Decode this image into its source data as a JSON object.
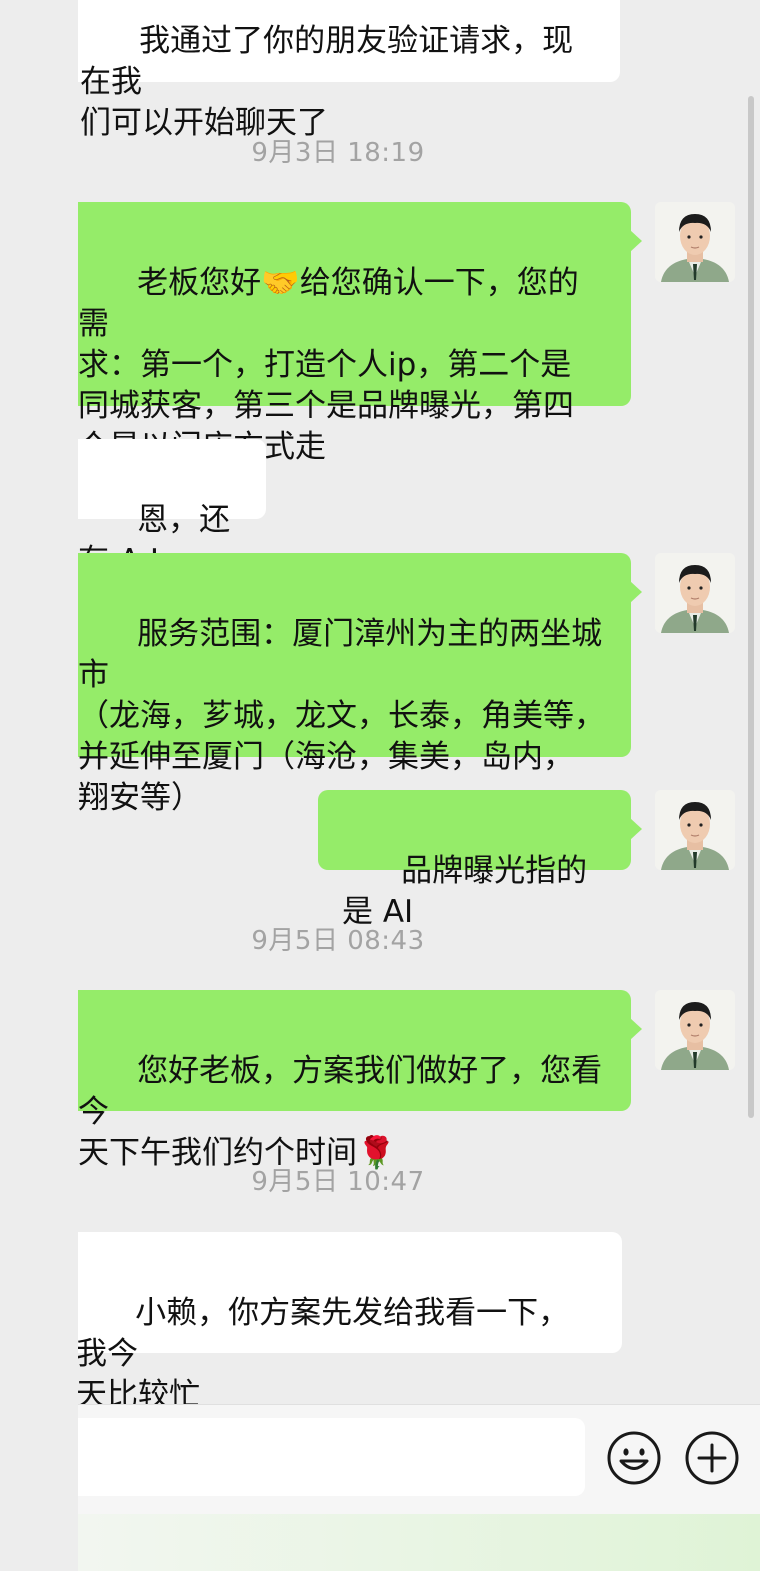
{
  "messages": [
    {
      "type": "in",
      "lines": [
        "我通过了你的朋友验证请求，现在我",
        "们可以开始聊天了"
      ]
    },
    {
      "type": "time",
      "text": "9月3日 18:19"
    },
    {
      "type": "out",
      "lines": [
        "老板您好🤝给您确认一下，您的需",
        "求：第一个，打造个人ip，第二个是",
        "同城获客，第三个是品牌曝光，第四",
        "个是以门店方式走"
      ]
    },
    {
      "type": "in",
      "lines": [
        "恩，还有 A I"
      ]
    },
    {
      "type": "out",
      "lines": [
        "服务范围：厦门漳州为主的两坐城市",
        "（龙海，芗城，龙文，长泰，角美等，",
        "并延伸至厦门（海沧，集美，岛内，",
        "翔安等）"
      ]
    },
    {
      "type": "out",
      "lines": [
        "品牌曝光指的是 AI"
      ]
    },
    {
      "type": "time",
      "text": "9月5日 08:43"
    },
    {
      "type": "out",
      "lines": [
        "您好老板，方案我们做好了，您看今",
        "天下午我们约个时间🌹"
      ]
    },
    {
      "type": "time",
      "text": "9月5日 10:47"
    },
    {
      "type": "in",
      "lines": [
        "小赖，你方案先发给我看一下，我今",
        "天比较忙"
      ]
    }
  ],
  "icons": {
    "emoji": "emoji-smile-icon",
    "more": "plus-circle-icon"
  },
  "colors": {
    "outgoing_bubble": "#95ec69",
    "incoming_bubble": "#ffffff",
    "background": "#ededed",
    "timestamp": "#a3a3a3"
  }
}
